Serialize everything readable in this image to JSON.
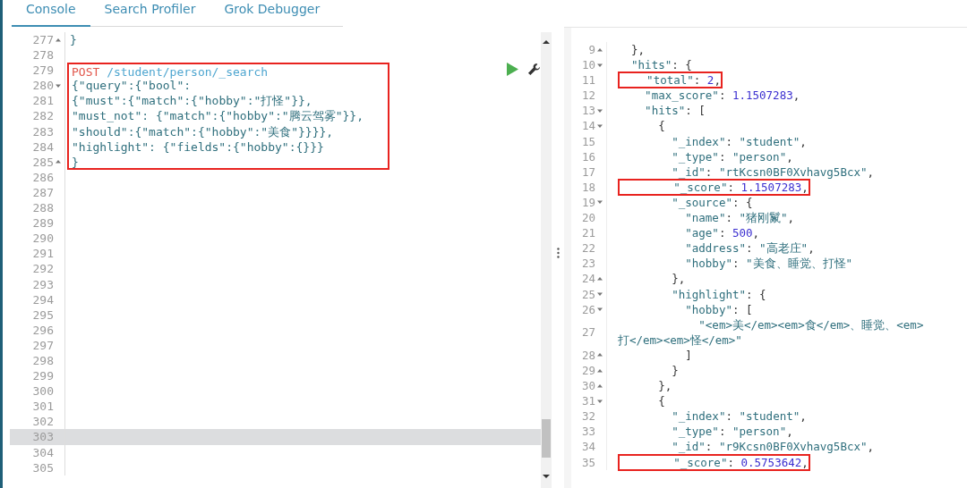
{
  "tabs": [
    {
      "label": "Console",
      "selected": true
    },
    {
      "label": "Search Profiler",
      "selected": false
    },
    {
      "label": "Grok Debugger",
      "selected": false
    }
  ],
  "request_editor": {
    "lines": [
      {
        "num": "277",
        "fold_start": false,
        "fold_end": true,
        "boxed": false,
        "active": false,
        "kind": "code",
        "text": "}"
      },
      {
        "num": "278",
        "fold_start": false,
        "fold_end": false,
        "boxed": false,
        "active": false,
        "kind": "code"
      },
      {
        "num": "279",
        "fold_start": false,
        "fold_end": false,
        "boxed": true,
        "active": false,
        "kind": "request",
        "method": "POST",
        "path": "/student/person/_search"
      },
      {
        "num": "280",
        "fold_start": true,
        "fold_end": false,
        "boxed": true,
        "active": false,
        "kind": "code",
        "text": "{\"query\":{\"bool\":"
      },
      {
        "num": "281",
        "fold_start": false,
        "fold_end": false,
        "boxed": true,
        "active": false,
        "kind": "code",
        "text": "{\"must\":{\"match\":{\"hobby\":\"打怪\"}},"
      },
      {
        "num": "282",
        "fold_start": false,
        "fold_end": false,
        "boxed": true,
        "active": false,
        "kind": "code",
        "text": "\"must_not\": {\"match\":{\"hobby\":\"腾云驾雾\"}},"
      },
      {
        "num": "283",
        "fold_start": false,
        "fold_end": false,
        "boxed": true,
        "active": false,
        "kind": "code",
        "text": "\"should\":{\"match\":{\"hobby\":\"美食\"}}}},"
      },
      {
        "num": "284",
        "fold_start": false,
        "fold_end": false,
        "boxed": true,
        "active": false,
        "kind": "code",
        "text": "\"highlight\": {\"fields\":{\"hobby\":{}}}"
      },
      {
        "num": "285",
        "fold_start": false,
        "fold_end": true,
        "boxed": true,
        "active": false,
        "kind": "code",
        "text": "}"
      },
      {
        "num": "286",
        "fold_start": false,
        "fold_end": false,
        "boxed": false,
        "active": false,
        "kind": "code"
      },
      {
        "num": "287",
        "fold_start": false,
        "fold_end": false,
        "boxed": false,
        "active": false,
        "kind": "code"
      },
      {
        "num": "288",
        "fold_start": false,
        "fold_end": false,
        "boxed": false,
        "active": false,
        "kind": "code"
      },
      {
        "num": "289",
        "fold_start": false,
        "fold_end": false,
        "boxed": false,
        "active": false,
        "kind": "code"
      },
      {
        "num": "290",
        "fold_start": false,
        "fold_end": false,
        "boxed": false,
        "active": false,
        "kind": "code"
      },
      {
        "num": "291",
        "fold_start": false,
        "fold_end": false,
        "boxed": false,
        "active": false,
        "kind": "code"
      },
      {
        "num": "292",
        "fold_start": false,
        "fold_end": false,
        "boxed": false,
        "active": false,
        "kind": "code"
      },
      {
        "num": "293",
        "fold_start": false,
        "fold_end": false,
        "boxed": false,
        "active": false,
        "kind": "code"
      },
      {
        "num": "294",
        "fold_start": false,
        "fold_end": false,
        "boxed": false,
        "active": false,
        "kind": "code"
      },
      {
        "num": "295",
        "fold_start": false,
        "fold_end": false,
        "boxed": false,
        "active": false,
        "kind": "code"
      },
      {
        "num": "296",
        "fold_start": false,
        "fold_end": false,
        "boxed": false,
        "active": false,
        "kind": "code"
      },
      {
        "num": "297",
        "fold_start": false,
        "fold_end": false,
        "boxed": false,
        "active": false,
        "kind": "code"
      },
      {
        "num": "298",
        "fold_start": false,
        "fold_end": false,
        "boxed": false,
        "active": false,
        "kind": "code"
      },
      {
        "num": "299",
        "fold_start": false,
        "fold_end": false,
        "boxed": false,
        "active": false,
        "kind": "code"
      },
      {
        "num": "300",
        "fold_start": false,
        "fold_end": false,
        "boxed": false,
        "active": false,
        "kind": "code"
      },
      {
        "num": "301",
        "fold_start": false,
        "fold_end": false,
        "boxed": false,
        "active": false,
        "kind": "code"
      },
      {
        "num": "302",
        "fold_start": false,
        "fold_end": false,
        "boxed": false,
        "active": false,
        "kind": "code"
      },
      {
        "num": "303",
        "fold_start": false,
        "fold_end": false,
        "boxed": false,
        "active": true,
        "kind": "code"
      },
      {
        "num": "304",
        "fold_start": false,
        "fold_end": false,
        "boxed": false,
        "active": false,
        "kind": "code"
      },
      {
        "num": "305",
        "fold_start": false,
        "fold_end": false,
        "boxed": false,
        "active": false,
        "kind": "code"
      }
    ]
  },
  "response_viewer": {
    "lines": [
      {
        "num": "9",
        "fold_start": false,
        "fold_end": true,
        "boxed": false,
        "text": "  },"
      },
      {
        "num": "10",
        "fold_start": true,
        "fold_end": false,
        "boxed": false,
        "text": "  \"hits\": {"
      },
      {
        "num": "11",
        "fold_start": false,
        "fold_end": false,
        "boxed": true,
        "text": "    \"total\": 2,"
      },
      {
        "num": "12",
        "fold_start": false,
        "fold_end": false,
        "boxed": false,
        "text": "    \"max_score\": 1.1507283,"
      },
      {
        "num": "13",
        "fold_start": true,
        "fold_end": false,
        "boxed": false,
        "text": "    \"hits\": ["
      },
      {
        "num": "14",
        "fold_start": true,
        "fold_end": false,
        "boxed": false,
        "text": "      {"
      },
      {
        "num": "15",
        "fold_start": false,
        "fold_end": false,
        "boxed": false,
        "text": "        \"_index\": \"student\","
      },
      {
        "num": "16",
        "fold_start": false,
        "fold_end": false,
        "boxed": false,
        "text": "        \"_type\": \"person\","
      },
      {
        "num": "17",
        "fold_start": false,
        "fold_end": false,
        "boxed": false,
        "text": "        \"_id\": \"rtKcsn0BF0Xvhavg5Bcx\","
      },
      {
        "num": "18",
        "fold_start": false,
        "fold_end": false,
        "boxed": true,
        "text": "        \"_score\": 1.1507283,"
      },
      {
        "num": "19",
        "fold_start": true,
        "fold_end": false,
        "boxed": false,
        "text": "        \"_source\": {"
      },
      {
        "num": "20",
        "fold_start": false,
        "fold_end": false,
        "boxed": false,
        "text": "          \"name\": \"猪刚鬣\","
      },
      {
        "num": "21",
        "fold_start": false,
        "fold_end": false,
        "boxed": false,
        "text": "          \"age\": 500,"
      },
      {
        "num": "22",
        "fold_start": false,
        "fold_end": false,
        "boxed": false,
        "text": "          \"address\": \"高老庄\","
      },
      {
        "num": "23",
        "fold_start": false,
        "fold_end": false,
        "boxed": false,
        "text": "          \"hobby\": \"美食、睡觉、打怪\""
      },
      {
        "num": "24",
        "fold_start": false,
        "fold_end": true,
        "boxed": false,
        "text": "        },"
      },
      {
        "num": "25",
        "fold_start": true,
        "fold_end": false,
        "boxed": false,
        "text": "        \"highlight\": {"
      },
      {
        "num": "26",
        "fold_start": true,
        "fold_end": false,
        "boxed": false,
        "text": "          \"hobby\": ["
      },
      {
        "num": "27",
        "fold_start": false,
        "fold_end": false,
        "boxed": false,
        "text": "            \"<em>美</em><em>食</em>、睡觉、<em>打</em><em>怪</em>\""
      },
      {
        "num": "28",
        "fold_start": false,
        "fold_end": true,
        "boxed": false,
        "text": "          ]"
      },
      {
        "num": "29",
        "fold_start": false,
        "fold_end": true,
        "boxed": false,
        "text": "        }"
      },
      {
        "num": "30",
        "fold_start": false,
        "fold_end": true,
        "boxed": false,
        "text": "      },"
      },
      {
        "num": "31",
        "fold_start": true,
        "fold_end": false,
        "boxed": false,
        "text": "      {"
      },
      {
        "num": "32",
        "fold_start": false,
        "fold_end": false,
        "boxed": false,
        "text": "        \"_index\": \"student\","
      },
      {
        "num": "33",
        "fold_start": false,
        "fold_end": false,
        "boxed": false,
        "text": "        \"_type\": \"person\","
      },
      {
        "num": "34",
        "fold_start": false,
        "fold_end": false,
        "boxed": false,
        "text": "        \"_id\": \"r9Kcsn0BF0Xvhavg5Bcx\","
      },
      {
        "num": "35",
        "fold_start": false,
        "fold_end": false,
        "boxed": true,
        "text": "        \"_score\": 0.5753642,"
      }
    ]
  }
}
